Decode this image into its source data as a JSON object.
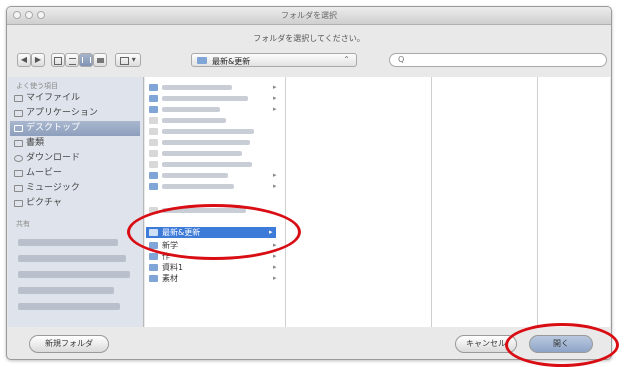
{
  "window": {
    "title": "フォルダを選択"
  },
  "prompt": "フォルダを選択してください。",
  "toolbar": {
    "back_label": "◀",
    "forward_label": "▶",
    "action_label": "▾",
    "location_label": "最新&更新",
    "location_arrow": "⌃",
    "search_glyph": "Q"
  },
  "sidebar": {
    "favorites_heading": "よく使う項目",
    "items": [
      {
        "label": "マイファイル",
        "selected": false
      },
      {
        "label": "アプリケーション",
        "selected": false
      },
      {
        "label": "デスクトップ",
        "selected": true
      },
      {
        "label": "書類",
        "selected": false
      },
      {
        "label": "ダウンロード",
        "selected": false
      },
      {
        "label": "ムービー",
        "selected": false
      },
      {
        "label": "ミュージック",
        "selected": false
      },
      {
        "label": "ピクチャ",
        "selected": false
      }
    ],
    "shared_heading": "共有"
  },
  "column1": {
    "selected_label": "最新&更新",
    "items_below": [
      {
        "label": "新学"
      },
      {
        "label": "作"
      },
      {
        "label": "資料1"
      },
      {
        "label": "素材"
      }
    ]
  },
  "footer": {
    "new_folder_label": "新規フォルダ",
    "cancel_label": "キャンセル",
    "open_label": "開く"
  },
  "colors": {
    "annotation": "#d90d14",
    "selection": "#3d7bd9"
  }
}
